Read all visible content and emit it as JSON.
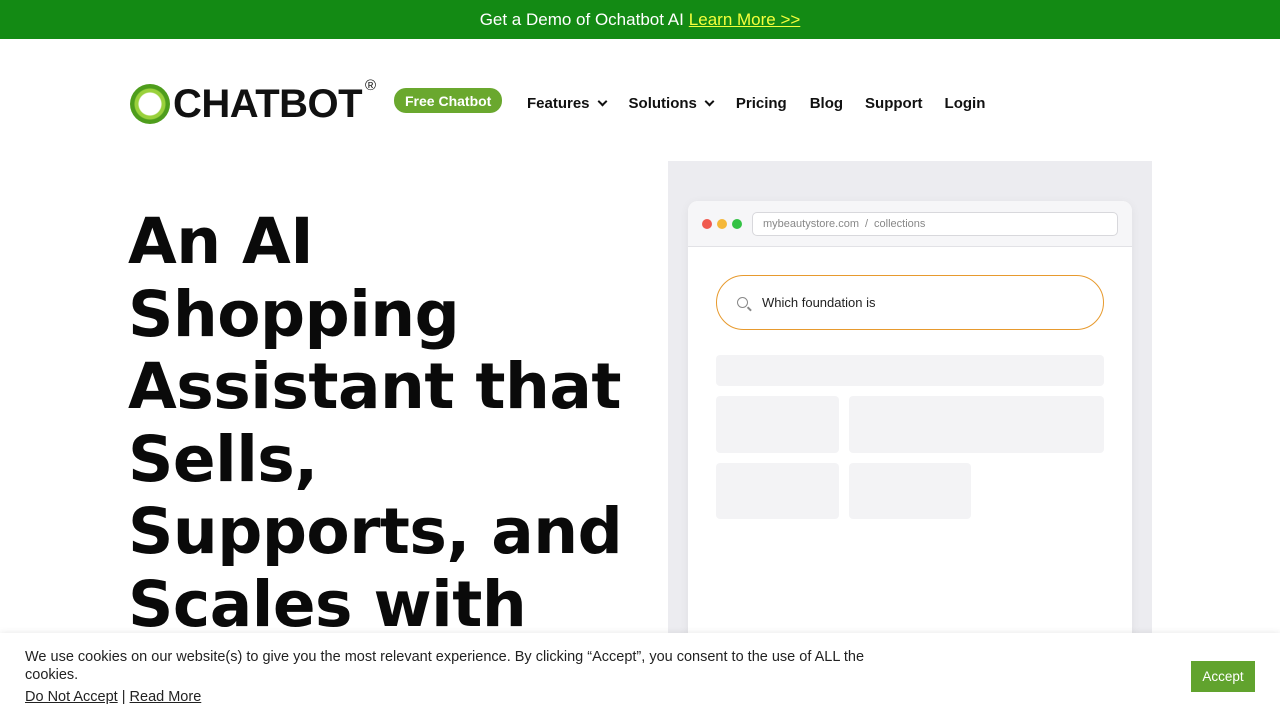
{
  "promo": {
    "text": "Get a Demo of Ochatbot AI",
    "link": "Learn More >>"
  },
  "logo": {
    "text": "CHATBOT",
    "reg": "®"
  },
  "nav": {
    "cta": "Free Chatbot",
    "items": [
      {
        "label": "Features",
        "dropdown": true
      },
      {
        "label": "Solutions",
        "dropdown": true
      },
      {
        "label": "Pricing"
      },
      {
        "label": "Blog"
      },
      {
        "label": "Support"
      },
      {
        "label": "Login"
      }
    ]
  },
  "hero": {
    "lines": [
      "An AI",
      "Shopping",
      "Assistant that",
      "Sells,",
      "Supports, and",
      "Scales with"
    ]
  },
  "mockup": {
    "url_domain": "mybeautystore.com",
    "url_sep": "/",
    "url_path": "collections",
    "search_text": "Which foundation is"
  },
  "cookie": {
    "text": "We use cookies on our website(s) to give you the most relevant experience. By clicking “Accept”, you consent to the use of ALL the cookies.",
    "decline": "Do Not Accept",
    "sep": "|",
    "read_more": "Read More",
    "accept": "Accept"
  },
  "colors": {
    "promo_bg": "#138a14",
    "promo_link": "#f5ff3c",
    "brand_green": "#6aa82e",
    "search_border": "#e79a2e"
  }
}
